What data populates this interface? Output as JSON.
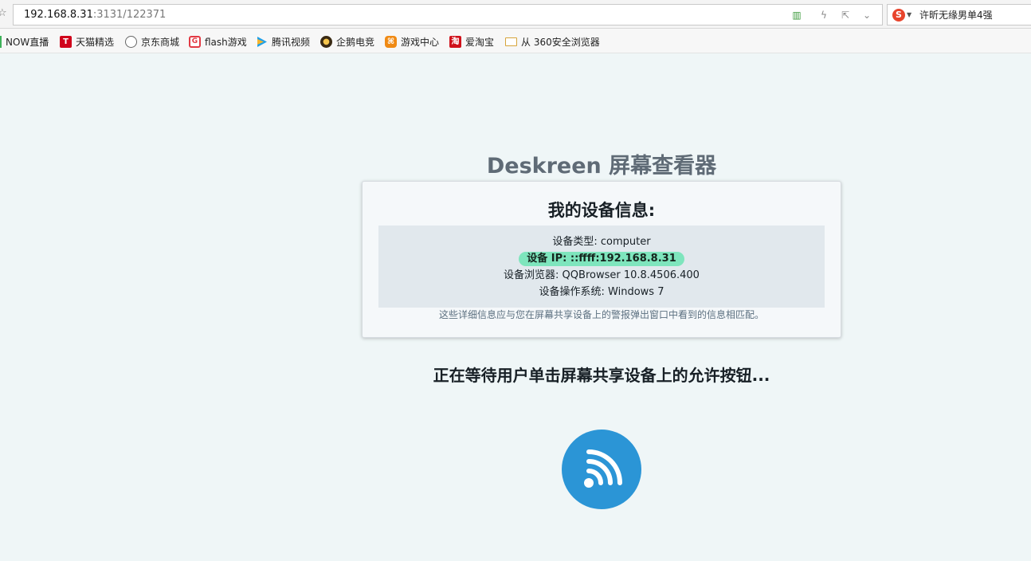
{
  "browser": {
    "address": {
      "host": "192.168.8.31",
      "port_path": ":3131/122371"
    },
    "search": {
      "engine_icon": "sogou-icon",
      "query": "许昕无缘男单4强"
    },
    "bookmarks": [
      {
        "label": "NOW直播",
        "icon": "now-live-icon"
      },
      {
        "label": "天猫精选",
        "icon": "tmall-icon"
      },
      {
        "label": "京东商城",
        "icon": "globe-icon"
      },
      {
        "label": "flash游戏",
        "icon": "flash-games-icon"
      },
      {
        "label": "腾讯视频",
        "icon": "tencent-video-icon"
      },
      {
        "label": "企鹅电竞",
        "icon": "penguin-esports-icon"
      },
      {
        "label": "游戏中心",
        "icon": "gamepad-icon"
      },
      {
        "label": "爱淘宝",
        "icon": "ai-taobao-icon"
      },
      {
        "label": "从 360安全浏览器",
        "icon": "folder-icon"
      }
    ]
  },
  "page": {
    "title": "Deskreen 屏幕查看器",
    "card": {
      "title": "我的设备信息:",
      "device_type": "设备类型: computer",
      "device_ip": "设备 IP: ::ffff:192.168.8.31",
      "device_browser": "设备浏览器: QQBrowser 10.8.4506.400",
      "device_os": "设备操作系统: Windows 7",
      "note": "这些详细信息应与您在屏幕共享设备上的警报弹出窗口中看到的信息相匹配。"
    },
    "waiting_text": "正在等待用户单击屏幕共享设备上的允许按钮...",
    "status_icon": "wifi-signal-icon"
  },
  "colors": {
    "page_background": "#eff6f7",
    "accent_blue": "#2b95d6",
    "ip_highlight": "#7ee5bd",
    "title_gray": "#5f6b76"
  }
}
